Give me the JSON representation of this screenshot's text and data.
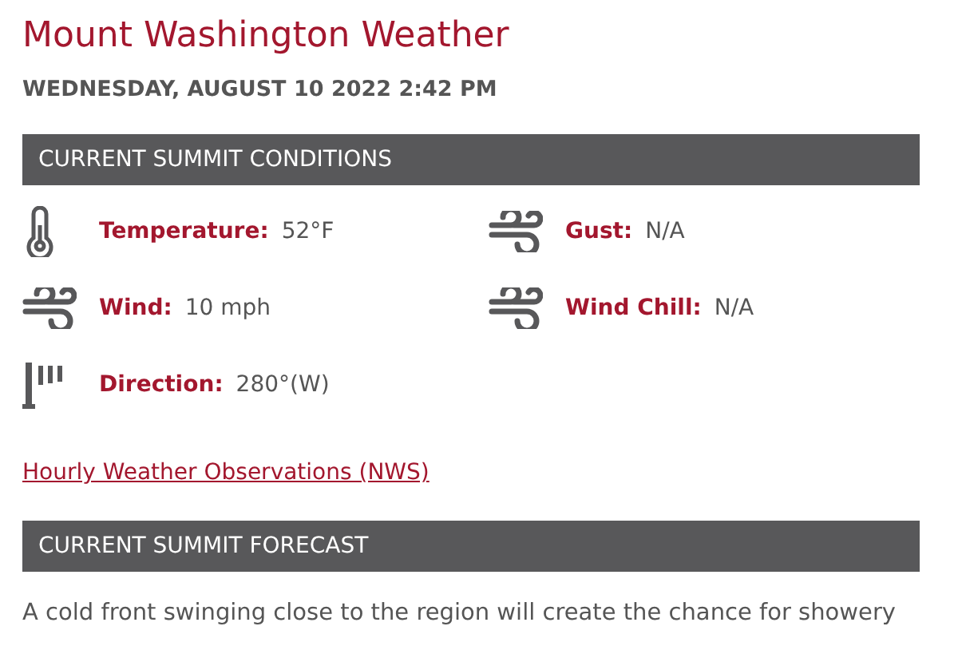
{
  "title": "Mount Washington Weather",
  "date": "WEDNESDAY, AUGUST 10 2022 2:42 PM",
  "sections": [
    {
      "heading": "CURRENT SUMMIT CONDITIONS",
      "conditions": [
        {
          "kind": "temperature",
          "label": "Temperature:",
          "value": "52°F"
        },
        {
          "kind": "wind",
          "label": "Gust:",
          "value": "N/A"
        },
        {
          "kind": "wind",
          "label": "Wind:",
          "value": "10 mph"
        },
        {
          "kind": "wind",
          "label": "Wind Chill:",
          "value": "N/A"
        },
        {
          "kind": "direction",
          "label": "Direction:",
          "value": "280°(W)"
        }
      ],
      "link": "Hourly Weather Observations (NWS)"
    },
    {
      "heading": "CURRENT SUMMIT FORECAST",
      "text": "A cold front swinging close to the region will create the chance for showery"
    }
  ]
}
